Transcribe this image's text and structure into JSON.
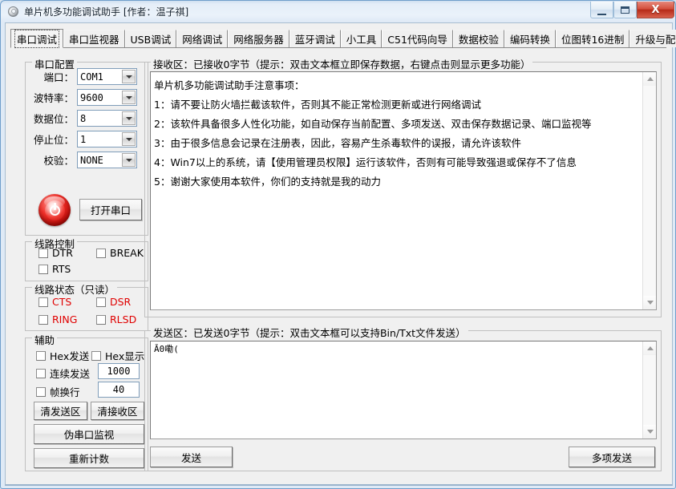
{
  "window": {
    "title": "单片机多功能调试助手 [作者：温子祺]",
    "icon": "gear-icon",
    "buttons": {
      "minimize": "–",
      "maximize": "□",
      "close": "X"
    },
    "accent": "#b62a18",
    "frame_color": "#6f9ecb"
  },
  "tabs": [
    {
      "label": "串口调试",
      "active": true
    },
    {
      "label": "串口监视器",
      "active": false
    },
    {
      "label": "USB调试",
      "active": false
    },
    {
      "label": "网络调试",
      "active": false
    },
    {
      "label": "网络服务器",
      "active": false
    },
    {
      "label": "蓝牙调试",
      "active": false
    },
    {
      "label": "小工具",
      "active": false
    },
    {
      "label": "C51代码向导",
      "active": false
    },
    {
      "label": "数据校验",
      "active": false
    },
    {
      "label": "编码转换",
      "active": false
    },
    {
      "label": "位图转16进制",
      "active": false
    },
    {
      "label": "升级与配置",
      "active": false
    }
  ],
  "serial_config": {
    "title": "串口配置",
    "fields": [
      {
        "label": "端口：",
        "value": "COM1"
      },
      {
        "label": "波特率：",
        "value": "9600"
      },
      {
        "label": "数据位：",
        "value": "8"
      },
      {
        "label": "停止位：",
        "value": "1"
      },
      {
        "label": "校验：",
        "value": "NONE"
      }
    ],
    "open_button": "打开串口",
    "power_icon": "power-icon"
  },
  "line_control": {
    "title": "线路控制",
    "items": [
      {
        "label": "DTR",
        "checked": false
      },
      {
        "label": "BREAK",
        "checked": false
      },
      {
        "label": "RTS",
        "checked": false
      }
    ]
  },
  "line_status": {
    "title": "线路状态（只读）",
    "color": "#e00000",
    "items": [
      {
        "label": "CTS",
        "checked": false
      },
      {
        "label": "DSR",
        "checked": false
      },
      {
        "label": "RING",
        "checked": false
      },
      {
        "label": "RLSD",
        "checked": false
      }
    ]
  },
  "auxiliary": {
    "title": "辅助",
    "hex_send": {
      "label": "Hex发送",
      "checked": false
    },
    "hex_display": {
      "label": "Hex显示",
      "checked": false
    },
    "continuous_send": {
      "label": "连续发送",
      "checked": false,
      "value": "1000"
    },
    "frame_newline": {
      "label": "帧换行",
      "checked": false,
      "value": "40"
    },
    "clear_send_button": "清发送区",
    "clear_recv_button": "清接收区",
    "fake_port_monitor_button": "伪串口监视",
    "recount_button": "重新计数"
  },
  "receive_area": {
    "title": "接收区：已接收0字节（提示：双击文本框立即保存数据，右键点击则显示更多功能）",
    "lines": [
      "单片机多功能调试助手注意事项：",
      "1：请不要让防火墙拦截该软件，否则其不能正常检测更新或进行网络调试",
      "2：该软件具备很多人性化功能，如自动保存当前配置、多项发送、双击保存数据记录、端口监视等",
      "3：由于很多信息会记录在注册表，因此，容易产生杀毒软件的误报，请允许该软件",
      "4：Win7以上的系统，请【使用管理员权限】运行该软件，否则有可能导致强退或保存不了信息",
      "5：谢谢大家使用本软件，你们的支持就是我的动力"
    ]
  },
  "send_area": {
    "title": "发送区：已发送0字节（提示：双击文本框可以支持Bin/Txt文件发送）",
    "content": "Ā0嘞(",
    "send_button": "发送",
    "multi_send_button": "多项发送"
  }
}
